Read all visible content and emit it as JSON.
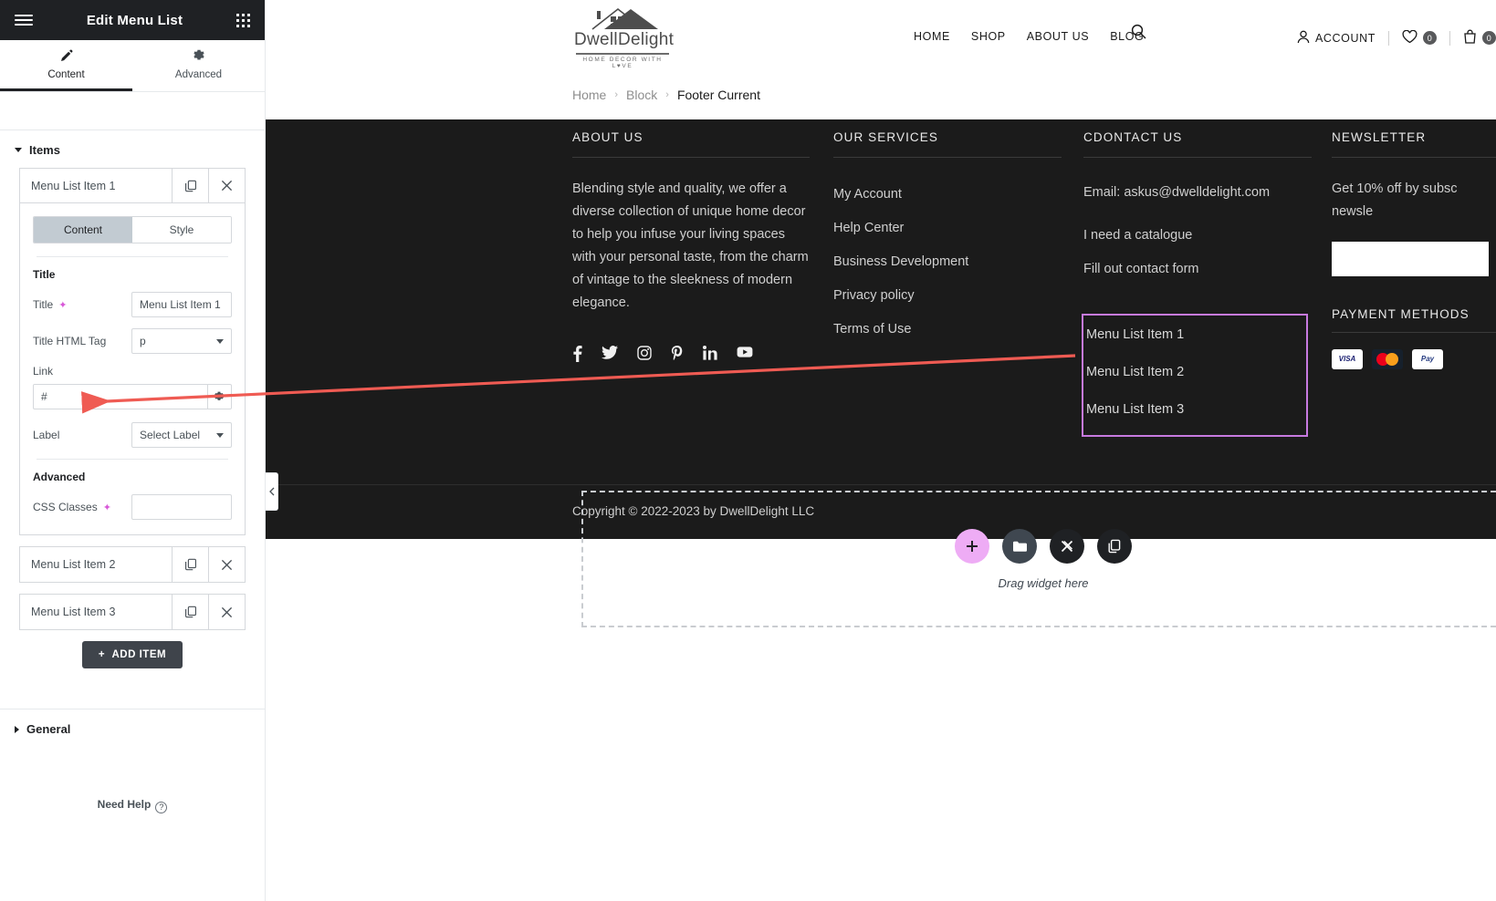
{
  "panel": {
    "title": "Edit Menu List",
    "menu_icon": "hamburger-icon",
    "apps_icon": "grid-apps-icon",
    "tabs": [
      {
        "label": "Content",
        "icon": "pencil-icon",
        "active": true
      },
      {
        "label": "Advanced",
        "icon": "gear-icon",
        "active": false
      }
    ],
    "items_section": {
      "label": "Items",
      "expanded": true,
      "repeater": [
        {
          "label": "Menu List Item 1",
          "open": true,
          "duplicate_icon": "duplicate-icon",
          "remove_icon": "close-icon",
          "sub_tabs": [
            {
              "label": "Content",
              "active": true
            },
            {
              "label": "Style",
              "active": false
            }
          ],
          "groups": {
            "title_group_label": "Title",
            "title_label": "Title",
            "title_ai_icon": "ai-sparkle-icon",
            "title_value": "Menu List Item 1",
            "html_tag_label": "Title HTML Tag",
            "html_tag_value": "p",
            "link_label": "Link",
            "link_value": "#",
            "link_options_icon": "gear-icon",
            "label_label": "Label",
            "label_value": "Select Label",
            "advanced_group_label": "Advanced",
            "css_classes_label": "CSS Classes",
            "css_classes_ai_icon": "ai-sparkle-icon",
            "css_classes_value": ""
          }
        },
        {
          "label": "Menu List Item 2",
          "open": false,
          "duplicate_icon": "duplicate-icon",
          "remove_icon": "close-icon"
        },
        {
          "label": "Menu List Item 3",
          "open": false,
          "duplicate_icon": "duplicate-icon",
          "remove_icon": "close-icon"
        }
      ],
      "add_item_label": "ADD ITEM",
      "add_item_icon": "plus-icon"
    },
    "general_section": {
      "label": "General",
      "expanded": false
    },
    "need_help": "Need Help",
    "need_help_icon": "question-circle-icon",
    "collapse_icon": "chevron-left-icon"
  },
  "site": {
    "logo": {
      "name": "DwellDelight",
      "tagline": "HOME DECOR WITH L♥VE",
      "icon": "house-logo-icon"
    },
    "nav": [
      "HOME",
      "SHOP",
      "ABOUT US",
      "BLOG"
    ],
    "search_icon": "search-icon",
    "account": {
      "label": "ACCOUNT",
      "icon": "user-icon"
    },
    "wishlist": {
      "count": "0",
      "icon": "heart-icon"
    },
    "cart": {
      "count": "0",
      "icon": "bag-icon"
    },
    "breadcrumb": [
      {
        "label": "Home",
        "current": false
      },
      {
        "label": "Block",
        "current": false
      },
      {
        "label": "Footer Current",
        "current": true
      }
    ],
    "breadcrumb_sep": "›"
  },
  "footer": {
    "about": {
      "heading": "ABOUT US",
      "text": "Blending style and quality, we offer a diverse collection of unique home decor to help you infuse your living spaces with your personal taste, from the charm of vintage to the sleekness of modern elegance.",
      "social": [
        {
          "name": "facebook-icon",
          "glyph": "f"
        },
        {
          "name": "twitter-icon",
          "glyph": "t"
        },
        {
          "name": "instagram-icon",
          "glyph": "i"
        },
        {
          "name": "pinterest-icon",
          "glyph": "p"
        },
        {
          "name": "linkedin-icon",
          "glyph": "in"
        },
        {
          "name": "youtube-icon",
          "glyph": "yt"
        }
      ]
    },
    "services": {
      "heading": "OUR SERVICES",
      "links": [
        "My Account",
        "Help Center",
        "Business Development",
        "Privacy policy",
        "Terms of Use"
      ]
    },
    "contact": {
      "heading": "CDONTACT US",
      "email": "Email: askus@dwelldelight.com",
      "links": [
        "I need a catalogue",
        "Fill out contact form"
      ],
      "menu_list": [
        "Menu List Item 1",
        "Menu List Item 2",
        "Menu List Item 3"
      ],
      "selection_color": "#c77ae0"
    },
    "newsletter": {
      "heading": "NEWSLETTER",
      "text": "Get 10% off by subsc newsle",
      "input_value": ""
    },
    "payment": {
      "heading": "PAYMENT METHODS",
      "methods": [
        "VISA",
        "MasterCard",
        "PayPal"
      ]
    },
    "copyright": "Copyright © 2022-2023 by DwellDelight LLC"
  },
  "dropzone": {
    "label": "Drag widget here",
    "buttons": [
      {
        "name": "add-element-button",
        "icon": "plus-icon",
        "color": "#eeacf5"
      },
      {
        "name": "folder-template-button",
        "icon": "folder-icon",
        "color": "#3f4750"
      },
      {
        "name": "ai-generate-button",
        "icon": "x-icon",
        "color": "#1f2124"
      },
      {
        "name": "paste-button",
        "icon": "duplicate-icon",
        "color": "#1f2124"
      }
    ]
  },
  "annotation": {
    "arrow_color": "#ef5b53"
  }
}
